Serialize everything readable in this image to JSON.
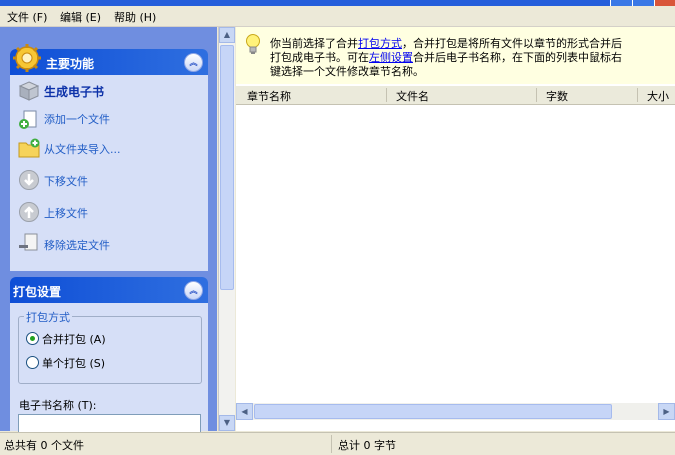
{
  "menu": [
    {
      "label": "文件 (F)"
    },
    {
      "label": "编辑 (E)"
    },
    {
      "label": "帮助 (H)"
    }
  ],
  "main_panel": {
    "title": "主要功能",
    "tasks": [
      {
        "label": "生成电子书",
        "icon": "package-icon"
      },
      {
        "label": "添加一个文件",
        "icon": "add-file-icon"
      },
      {
        "label": "从文件夹导入...",
        "icon": "folder-import-icon"
      },
      {
        "label": "下移文件",
        "icon": "move-down-icon"
      },
      {
        "label": "上移文件",
        "icon": "move-up-icon"
      },
      {
        "label": "移除选定文件",
        "icon": "remove-file-icon"
      }
    ]
  },
  "pack_panel": {
    "title": "打包设置",
    "group_title": "打包方式",
    "options": [
      {
        "label": "合并打包 (A)",
        "selected": true
      },
      {
        "label": "单个打包 (S)",
        "selected": false
      }
    ],
    "ebook_name_label": "电子书名称 (T):",
    "ebook_name_value": ""
  },
  "info": {
    "p1": "你当前选择了合并",
    "link1": "打包方式",
    "p2": "，合并打包是将所有文件以章节的形式合并后",
    "p3": "打包成电子书。可在",
    "link2": "左侧设置",
    "p4": "合并后电子书名称，在下面的列表中鼠标右",
    "p5": "键选择一个文件修改章节名称。"
  },
  "table": {
    "columns": [
      "章节名称",
      "文件名",
      "字数",
      "大小"
    ]
  },
  "status": {
    "left": "总共有 0 个文件",
    "right": "总计 0 字节"
  }
}
